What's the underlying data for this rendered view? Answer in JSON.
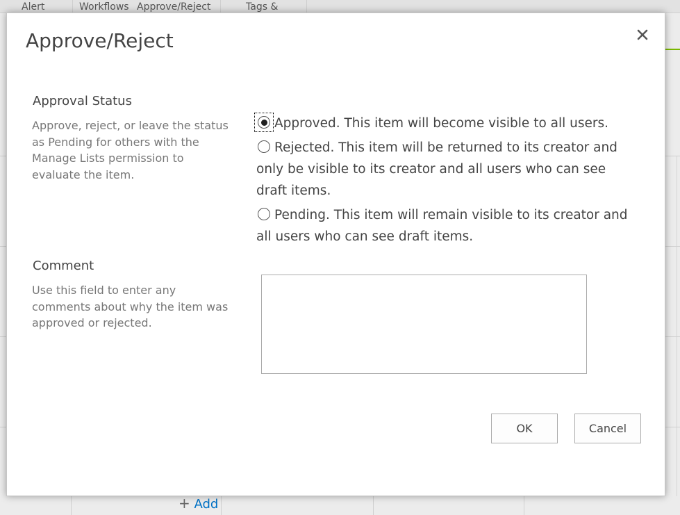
{
  "background": {
    "ribbon_tabs": [
      "Alert",
      "Workflows",
      "Approve/Reject",
      "Tags &"
    ],
    "add_link": "Add"
  },
  "dialog": {
    "title": "Approve/Reject",
    "close_icon": "close-icon",
    "approval_section": {
      "title": "Approval Status",
      "description": "Approve, reject, or leave the status as Pending for others with the Manage Lists permission to evaluate the item.",
      "options": [
        {
          "label": "Approved. This item will become visible to all users.",
          "checked": true
        },
        {
          "label": "Rejected. This item will be returned to its creator and only be visible to its creator and all users who can see draft items.",
          "checked": false
        },
        {
          "label": "Pending. This item will remain visible to its creator and all users who can see draft items.",
          "checked": false
        }
      ]
    },
    "comment_section": {
      "title": "Comment",
      "description": "Use this field to enter any comments about why the item was approved or rejected.",
      "value": ""
    },
    "buttons": {
      "ok": "OK",
      "cancel": "Cancel"
    }
  }
}
